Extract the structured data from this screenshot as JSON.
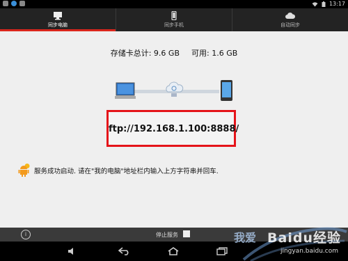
{
  "status_bar": {
    "time": "13:17"
  },
  "tabs": [
    {
      "label": "同步电脑",
      "icon": "monitor-icon",
      "active": true
    },
    {
      "label": "同步手机",
      "icon": "phone-icon",
      "active": false
    },
    {
      "label": "自动同步",
      "icon": "cloud-icon",
      "active": false
    }
  ],
  "storage": {
    "total_label": "存储卡总计: 9.6 GB",
    "free_label": "可用: 1.6 GB"
  },
  "ftp_address": "ftp://192.168.1.100:8888/",
  "message": "服务成功启动. 请在\"我的电脑\"地址栏内输入上方字符串并回车.",
  "bottom_bar": {
    "stop_label": "停止服务",
    "info_icon": "info-icon"
  },
  "watermark": {
    "slogan": "我爱",
    "brand": "Baidu经验",
    "url": "jingyan.baidu.com"
  },
  "colors": {
    "accent": "#d9261c",
    "highlight_box": "#e5141a",
    "tabbar_bg": "#232323"
  }
}
